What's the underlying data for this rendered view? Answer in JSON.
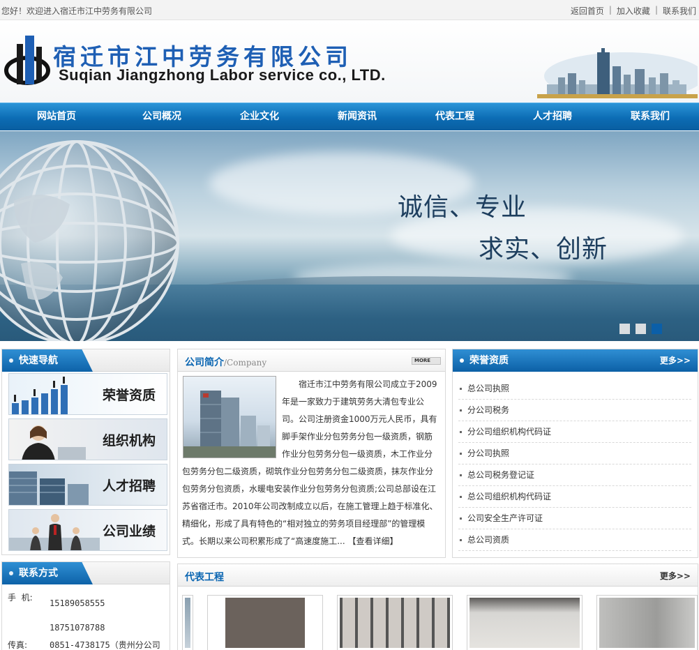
{
  "topbar": {
    "welcome": "您好！欢迎进入宿迁市江中劳务有限公司",
    "links": [
      "返回首页",
      "加入收藏",
      "联系我们"
    ]
  },
  "header": {
    "company_cn": "宿迁市江中劳务有限公司",
    "company_en": "Suqian Jiangzhong Labor service co., LTD."
  },
  "nav": [
    "网站首页",
    "公司概况",
    "企业文化",
    "新闻资讯",
    "代表工程",
    "人才招聘",
    "联系我们"
  ],
  "banner": {
    "slogan_line1": "诚信、专业",
    "slogan_line2": "求实、创新",
    "slides_total": 3,
    "active_slide": 3
  },
  "quick_nav": {
    "title": "快速导航",
    "items": [
      "荣誉资质",
      "组织机构",
      "人才招聘",
      "公司业绩"
    ]
  },
  "contact": {
    "title": "联系方式",
    "mobile_label": "手  机:",
    "mobile1": "15189058555",
    "mobile2": "18751078788",
    "fax_label": "传真:",
    "fax": "0851-4738175（贵州分公司"
  },
  "intro": {
    "title": "公司简介",
    "subtitle": "/Company",
    "more": "MORE",
    "text": "宿迁市江中劳务有限公司成立于2009年是一家致力于建筑劳务大清包专业公司。公司注册资金1000万元人民币，具有脚手架作业分包劳务分包一级资质，钢筋作业分包劳务分包一级资质，木工作业分包劳务分包二级资质，砌筑作业分包劳务分包二级资质，抹灰作业分包劳务分包资质，水暖电安装作业分包劳务分包资质;公司总部设在江苏省宿迁市。2010年公司改制成立以后，在施工管理上趋于标准化、精细化，形成了具有特色的“相对独立的劳务项目经理部”的管理模式。长期以来公司积累形成了“高速度施工...",
    "detail": "【查看详细】"
  },
  "honors": {
    "title": "荣誉资质",
    "more": "更多>>",
    "items": [
      "总公司执照",
      "分公司税务",
      "分公司组织机构代码证",
      "分公司执照",
      "总公司税务登记证",
      "总公司组织机构代码证",
      "公司安全生产许可证",
      "总公司资质"
    ]
  },
  "projects": {
    "title": "代表工程",
    "more": "更多>>"
  }
}
